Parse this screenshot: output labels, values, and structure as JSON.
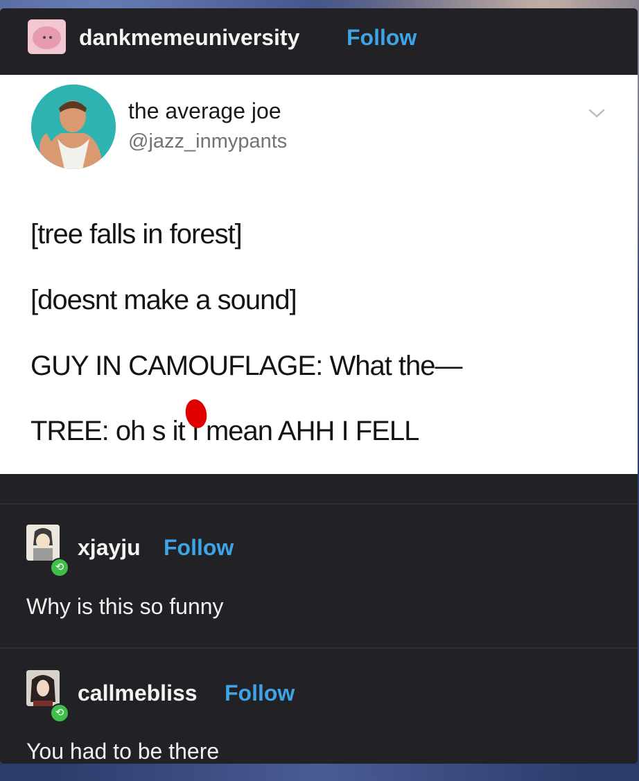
{
  "header": {
    "blog_name": "dankmemeuniversity",
    "follow_label": "Follow"
  },
  "tweet": {
    "display_name": "the average joe",
    "handle": "@jazz_inmypants",
    "lines": [
      "[tree falls in forest]",
      "[doesnt make a sound]",
      "GUY IN CAMOUFLAGE: What the—",
      "TREE: oh s  it I mean AHH I FELL"
    ]
  },
  "reblogs": [
    {
      "username": "xjayju",
      "follow_label": "Follow",
      "comment": "Why is this so funny"
    },
    {
      "username": "callmebliss",
      "follow_label": "Follow",
      "comment": "You had to be there"
    }
  ],
  "icons": {
    "reblog_badge": "reblog-icon",
    "tweet_menu": "chevron-down-icon"
  },
  "colors": {
    "follow": "#3fa4e6",
    "card_bg": "#222226",
    "reblog_badge": "#3fbf4a"
  }
}
